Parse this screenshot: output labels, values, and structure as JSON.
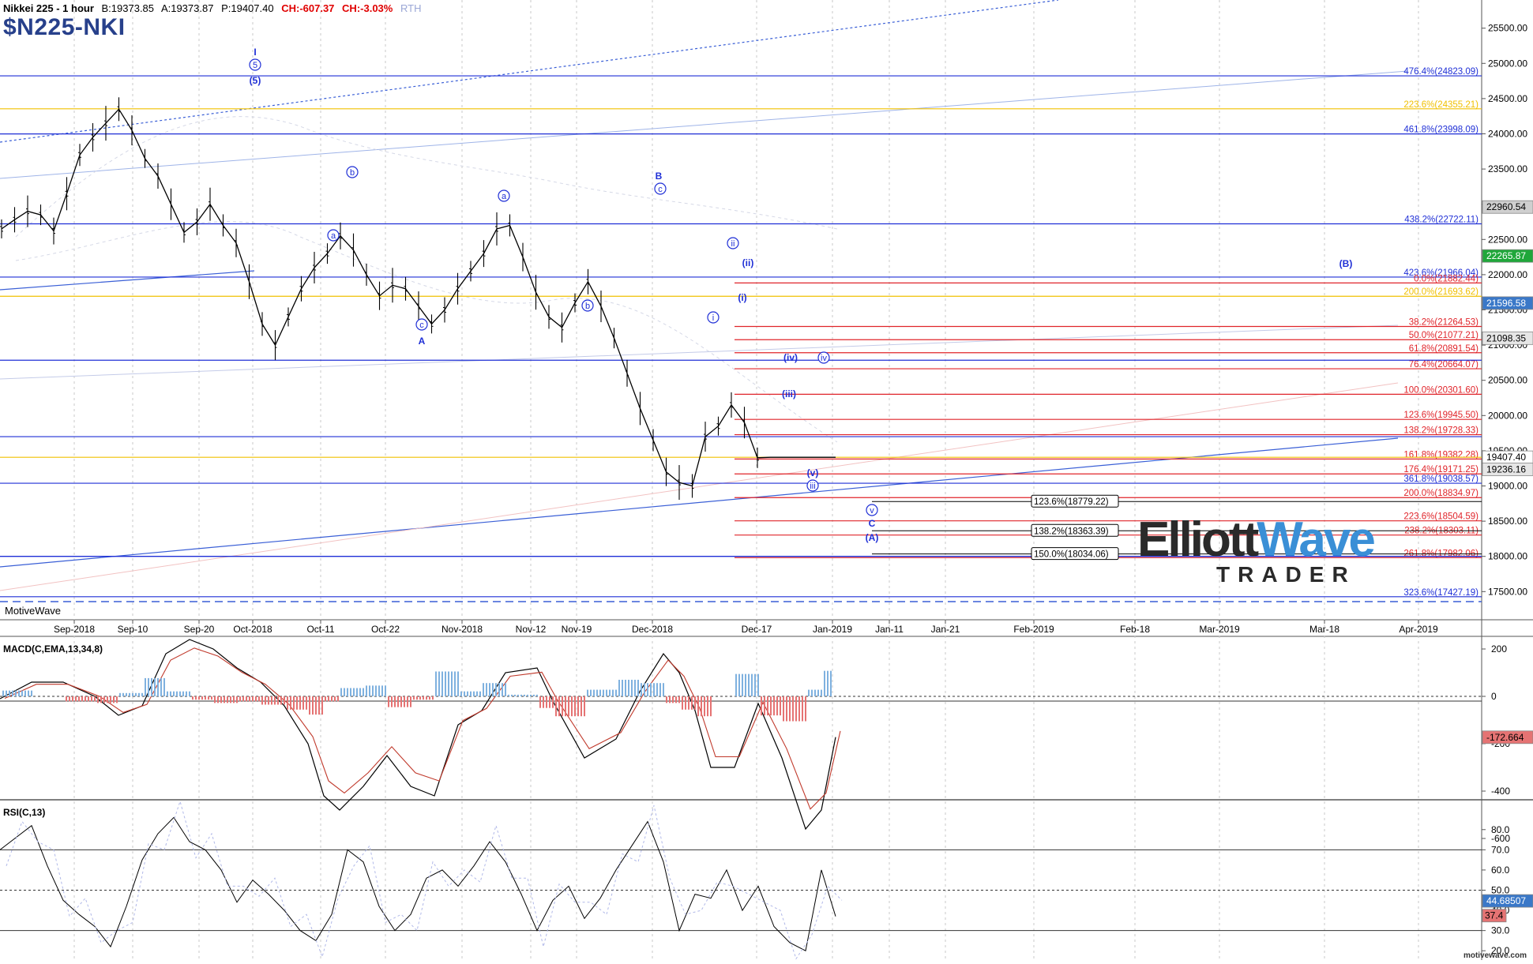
{
  "header": {
    "instrument": "Nikkei 225 - 1 hour",
    "bid": "B:19373.85",
    "ask": "A:19373.87",
    "price": "P:19407.40",
    "change": "CH:-607.37",
    "change_pct": "CH:-3.03%",
    "session": "RTH",
    "symbol": "$N225-NKI"
  },
  "watermark": "MotiveWave",
  "credit": "motivewave.com",
  "logo": {
    "word1": "Elliott",
    "word2": "Wave",
    "word3": "TRADER"
  },
  "colors": {
    "price": "#000000",
    "fib_blue": "#1f2fd6",
    "fib_red": "#e0242a",
    "fib_gold": "#f0c000",
    "label_blue": "#1f2fd6"
  },
  "chart_data": [
    {
      "type": "line",
      "title": "$N225-NKI",
      "xlabel": "",
      "ylabel": "",
      "ylim": [
        17100,
        25900
      ],
      "x_ticks": [
        "Sep-2018",
        "Sep-10",
        "Sep-20",
        "Oct-2018",
        "Oct-11",
        "Oct-22",
        "Nov-2018",
        "Nov-12",
        "Nov-19",
        "Dec-2018",
        "Dec-17",
        "Jan-2019",
        "Jan-11",
        "Jan-21",
        "Feb-2019",
        "Feb-18",
        "Mar-2019",
        "Mar-18",
        "Apr-2019"
      ],
      "y_ticks": [
        "25500.00",
        "25000.00",
        "24500.00",
        "24000.00",
        "23500.00",
        "23000.00",
        "22500.00",
        "22000.00",
        "21500.00",
        "21000.00",
        "20500.00",
        "20000.00",
        "19500.00",
        "19000.00",
        "18500.00",
        "18000.00",
        "17500.00"
      ],
      "series": [
        {
          "x": [
            0,
            4,
            8,
            12,
            16,
            20,
            24,
            28,
            32,
            36,
            40,
            44,
            48,
            52,
            56,
            60,
            64,
            68,
            72,
            76,
            80,
            84,
            88,
            92,
            96,
            100,
            104,
            108,
            112,
            116,
            120,
            124,
            128,
            132,
            136,
            140,
            144,
            148,
            152,
            156,
            160,
            164,
            168,
            172,
            176,
            180,
            184,
            188,
            192,
            196,
            200,
            204,
            208,
            212,
            216,
            220,
            224,
            228,
            232,
            236,
            240,
            244,
            248,
            252,
            256
          ],
          "values": [
            22650,
            22780,
            22900,
            22850,
            22620,
            23150,
            23700,
            23950,
            24150,
            24350,
            24050,
            23650,
            23400,
            23000,
            22600,
            22750,
            23000,
            22700,
            22450,
            21900,
            21300,
            21000,
            21400,
            21800,
            22100,
            22300,
            22550,
            22350,
            22000,
            21700,
            21850,
            21800,
            21550,
            21300,
            21500,
            21800,
            22050,
            22300,
            22650,
            22700,
            22250,
            21750,
            21400,
            21250,
            21600,
            21900,
            21550,
            21100,
            20600,
            20100,
            19650,
            19200,
            19050,
            19000,
            19700,
            19850,
            20150,
            19900,
            19400,
            19407,
            19407,
            19407,
            19407,
            19407,
            19407
          ]
        }
      ],
      "annotations": [
        "I",
        "(5)",
        "5",
        "a",
        "b",
        "a",
        "c",
        "A",
        "a",
        "b",
        "B",
        "c",
        "i",
        "ii",
        "(i)",
        "(ii)",
        "(iii)",
        "(iv)",
        "(v)",
        "iii",
        "iv",
        "v",
        "C",
        "(A)",
        "(B)"
      ],
      "fib_levels": [
        {
          "label": "476.4%(24823.09)",
          "value": 24823.09,
          "color": "#1f2fd6"
        },
        {
          "label": "223.6%(24355.21)",
          "value": 24355.21,
          "color": "#f0c000"
        },
        {
          "label": "461.8%(23998.09)",
          "value": 23998.09,
          "color": "#1f2fd6"
        },
        {
          "label": "438.2%(22722.11)",
          "value": 22722.11,
          "color": "#1f2fd6"
        },
        {
          "label": "423.6%(21966.04)",
          "value": 21966.04,
          "color": "#1f2fd6"
        },
        {
          "label": "0.0%(21882.44)",
          "value": 21882.44,
          "color": "#e0242a"
        },
        {
          "label": "200.0%(21693.62)",
          "value": 21693.62,
          "color": "#f0c000"
        },
        {
          "label": "38.2%(21264.53)",
          "value": 21264.53,
          "color": "#e0242a"
        },
        {
          "label": "50.0%(21077.21)",
          "value": 21077.21,
          "color": "#e0242a"
        },
        {
          "label": "61.8%(20891.54)",
          "value": 20891.54,
          "color": "#e0242a"
        },
        {
          "label": "76.4%(20664.07)",
          "value": 20664.07,
          "color": "#e0242a"
        },
        {
          "label": "100.0%(20301.60)",
          "value": 20301.6,
          "color": "#e0242a"
        },
        {
          "label": "123.6%(19945.50)",
          "value": 19945.5,
          "color": "#e0242a"
        },
        {
          "label": "138.2%(19728.33)",
          "value": 19728.33,
          "color": "#e0242a"
        },
        {
          "label": "161.8%(19382.28)",
          "value": 19382.28,
          "color": "#e0242a"
        },
        {
          "label": "176.4%(19171.25)",
          "value": 19171.25,
          "color": "#e0242a"
        },
        {
          "label": "361.8%(19038.57)",
          "value": 19038.57,
          "color": "#1f2fd6"
        },
        {
          "label": "200.0%(18834.97)",
          "value": 18834.97,
          "color": "#e0242a"
        },
        {
          "label": "223.6%(18504.59)",
          "value": 18504.59,
          "color": "#e0242a"
        },
        {
          "label": "238.2%(18303.11)",
          "value": 18303.11,
          "color": "#e0242a"
        },
        {
          "label": "261.8%(17982.06)",
          "value": 17982.06,
          "color": "#e0242a"
        },
        {
          "label": "323.6%(17427.19)",
          "value": 17427.19,
          "color": "#1f2fd6"
        }
      ],
      "boxed_levels": [
        {
          "label": "123.6%(18779.22)",
          "value": 18779.22
        },
        {
          "label": "138.2%(18363.39)",
          "value": 18363.39
        },
        {
          "label": "150.0%(18034.06)",
          "value": 18034.06
        }
      ],
      "price_tags": [
        "22960.54",
        "22265.87",
        "21596.58",
        "21098.35",
        "19407.40",
        "19236.16"
      ]
    },
    {
      "type": "line",
      "title": "MACD(C,EMA,13,34,8)",
      "ylim": [
        -700,
        280
      ],
      "y_ticks": [
        "200",
        "0",
        "-200",
        "-400",
        "-600"
      ],
      "value_tag": "-172.664"
    },
    {
      "type": "line",
      "title": "RSI(C,13)",
      "ylim": [
        15,
        90
      ],
      "y_ticks": [
        "80.0",
        "70.0",
        "60.0",
        "50.0",
        "40.0",
        "30.0",
        "20.0"
      ],
      "value_tags": [
        "44.68507",
        "37.4"
      ]
    }
  ]
}
